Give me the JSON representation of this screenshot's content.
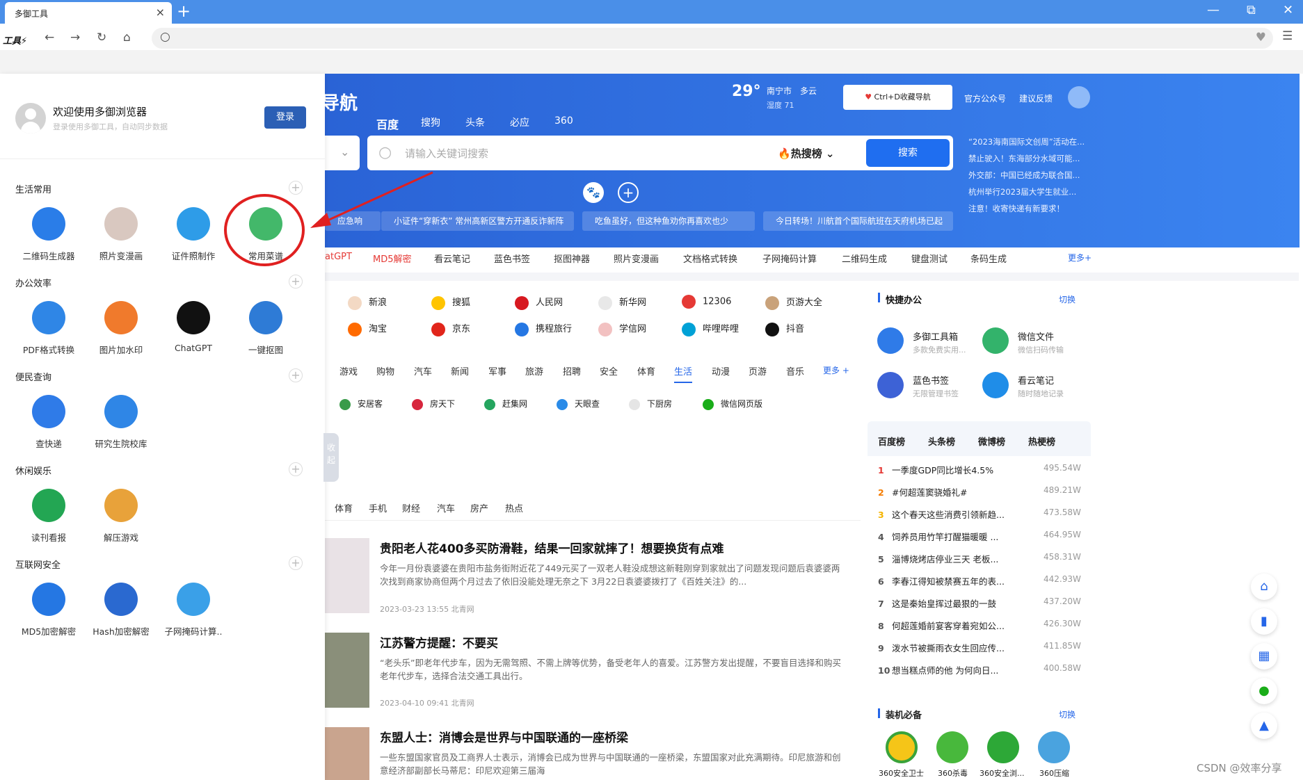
{
  "window": {
    "tab_title": "多御工具",
    "tab_close": "×",
    "new_tab": "+",
    "min": "—",
    "restore": "⧉",
    "close": "✕"
  },
  "toolbar": {
    "brand": "工具⚡",
    "back": "←",
    "forward": "→",
    "reload": "↻",
    "home": "⌂",
    "search_icon": "○",
    "heart": "♥",
    "menu": "☰"
  },
  "panel": {
    "welcome": "欢迎使用多御浏览器",
    "subtitle": "登录使用多御工具，自动同步数据",
    "login": "登录",
    "sections": [
      {
        "title": "生活常用",
        "apps": [
          "二维码生成器",
          "照片变漫画",
          "证件照制作",
          "常用菜谱"
        ]
      },
      {
        "title": "办公效率",
        "apps": [
          "PDF格式转换",
          "图片加水印",
          "ChatGPT",
          "一键抠图"
        ]
      },
      {
        "title": "便民查询",
        "apps": [
          "查快递",
          "研究生院校库"
        ]
      },
      {
        "title": "休闲娱乐",
        "apps": [
          "读刊看报",
          "解压游戏"
        ]
      },
      {
        "title": "互联网安全",
        "apps": [
          "MD5加密解密",
          "Hash加密解密",
          "子网掩码计算.."
        ]
      }
    ],
    "collapse": "收起"
  },
  "hero": {
    "title": "导航",
    "engines": [
      "百度",
      "搜狗",
      "头条",
      "必应",
      "360"
    ],
    "temp": "29°",
    "city": "南宁市　多云",
    "humidity": "湿度 71",
    "fav": "Ctrl+D收藏导航",
    "links": [
      "官方公众号",
      "建议反馈"
    ],
    "placeholder": "请输入关键词搜索",
    "hot": "热搜榜",
    "search_btn": "搜索",
    "news": [
      "“2023海南国际文创周”活动在...",
      "禁止驶入！东海部分水域可能...",
      "外交部：中国已经成为联合国...",
      "杭州举行2023届大学生就业...",
      "注意！收寄快递有新要求！"
    ],
    "tickers": [
      "应急响",
      "小证件“穿新衣” 常州高新区警方开通反诈新阵",
      "吃鱼虽好，但这种鱼劝你再喜欢也少",
      "今日转场！川航首个国际航班在天府机场已起"
    ]
  },
  "quicklinks": [
    "atGPT",
    "MD5解密",
    "看云笔记",
    "蓝色书签",
    "抠图神器",
    "照片变漫画",
    "文档格式转换",
    "子网掩码计算",
    "二维码生成",
    "键盘测试",
    "条码生成",
    "更多+"
  ],
  "sites": [
    [
      "新浪",
      "搜狐",
      "人民网",
      "新华网",
      "12306",
      "页游大全"
    ],
    [
      "淘宝",
      "京东",
      "携程旅行",
      "学信网",
      "哔哩哔哩",
      "抖音"
    ]
  ],
  "categories": [
    "游戏",
    "购物",
    "汽车",
    "新闻",
    "军事",
    "旅游",
    "招聘",
    "安全",
    "体育",
    "生活",
    "动漫",
    "页游",
    "音乐",
    "更多 +"
  ],
  "cat_sites": [
    "安居客",
    "房天下",
    "赶集网",
    "天眼查",
    "下厨房",
    "微信网页版"
  ],
  "news_tabs": [
    "体育",
    "手机",
    "财经",
    "汽车",
    "房产",
    "热点"
  ],
  "articles": [
    {
      "title": "贵阳老人花400多买防滑鞋，结果一回家就摔了！想要换货有点难",
      "body": "今年一月份袁婆婆在贵阳市盐务街附近花了449元买了一双老人鞋没成想这新鞋刚穿到家就出了问题发现问题后袁婆婆两次找到商家协商但两个月过去了依旧没能处理无奈之下 3月22日袁婆婆拨打了《百姓关注》的...",
      "meta": "2023-03-23 13:55  北青网"
    },
    {
      "title": "江苏警方提醒：不要买",
      "body": "“老头乐”即老年代步车，因为无需驾照、不需上牌等优势，备受老年人的喜爱。江苏警方发出提醒，不要盲目选择和购买老年代步车，选择合法交通工具出行。",
      "meta": "2023-04-10 09:41  北青网"
    },
    {
      "title": "东盟人士：消博会是世界与中国联通的一座桥梁",
      "body": "一些东盟国家官员及工商界人士表示，消博会已成为世界与中国联通的一座桥梁，东盟国家对此充满期待。印尼旅游和创意经济部副部长马蒂尼：印尼欢迎第三届海",
      "meta": ""
    }
  ],
  "office": {
    "title": "快捷办公",
    "switch": "切换",
    "items": [
      {
        "name": "多御工具箱",
        "desc": "多款免费实用..."
      },
      {
        "name": "微信文件",
        "desc": "微信扫码传输"
      },
      {
        "name": "蓝色书签",
        "desc": "无限管理书签"
      },
      {
        "name": "看云笔记",
        "desc": "随时随地记录"
      }
    ]
  },
  "ranks": {
    "tabs": [
      "百度榜",
      "头条榜",
      "微博榜",
      "热梗榜"
    ],
    "items": [
      [
        "1",
        "一季度GDP同比增长4.5%",
        "495.54W"
      ],
      [
        "2",
        "#何超莲窦骁婚礼#",
        "489.21W"
      ],
      [
        "3",
        "这个春天这些消费引领新趋...",
        "473.58W"
      ],
      [
        "4",
        "饲养员用竹竿打醒猫暖暖 ...",
        "464.95W"
      ],
      [
        "5",
        "淄博烧烤店停业三天 老板...",
        "458.31W"
      ],
      [
        "6",
        "李春江得知被禁赛五年的表...",
        "442.93W"
      ],
      [
        "7",
        "这是秦始皇挥过最狠的一鼓",
        "437.20W"
      ],
      [
        "8",
        "何超莲婚前宴客穿着宛如公...",
        "426.30W"
      ],
      [
        "9",
        "泼水节被撕雨衣女生回应传...",
        "411.85W"
      ],
      [
        "10",
        "想当糕点师的他 为何向日...",
        "400.58W"
      ]
    ]
  },
  "install": {
    "title": "装机必备",
    "switch": "切换",
    "apps": [
      "360安全卫士",
      "360杀毒",
      "360安全浏...",
      "360压缩"
    ]
  },
  "watermark": "CSDN @效率分享",
  "colors": {
    "titlebar": "#4a8fe8",
    "accent": "#1f6ef0",
    "hero": "#2a63d6",
    "annotation": "#e02020"
  }
}
